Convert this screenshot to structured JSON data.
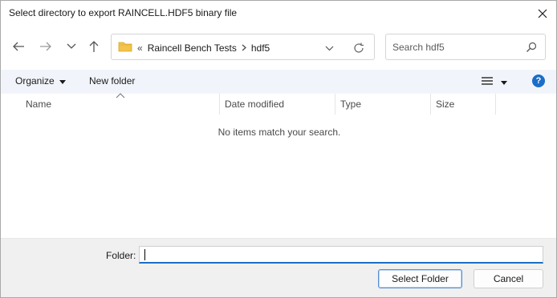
{
  "window": {
    "title": "Select directory to export RAINCELL.HDF5 binary file"
  },
  "address": {
    "overflow": "«",
    "crumbs": [
      "Raincell Bench Tests",
      "hdf5"
    ]
  },
  "search": {
    "placeholder": "Search hdf5"
  },
  "toolbar": {
    "organize_label": "Organize",
    "new_folder_label": "New folder"
  },
  "columns": {
    "name": "Name",
    "date_modified": "Date modified",
    "type": "Type",
    "size": "Size"
  },
  "file_list": {
    "empty_message": "No items match your search."
  },
  "footer": {
    "folder_label": "Folder:",
    "folder_value": "",
    "select_button": "Select Folder",
    "cancel_button": "Cancel"
  },
  "colors": {
    "accent": "#1a6ec7",
    "folder_icon": "#f3c34a",
    "command_bar_bg": "#f1f5fb",
    "footer_bg": "#f0f0f0"
  },
  "icons": {
    "back": "arrow-left-icon",
    "forward": "arrow-right-icon",
    "recent": "chevron-down-icon",
    "up": "arrow-up-icon",
    "folder": "folder-icon",
    "refresh": "refresh-icon",
    "search": "search-icon",
    "view": "view-list-icon",
    "help": "help-icon",
    "close": "close-icon"
  }
}
